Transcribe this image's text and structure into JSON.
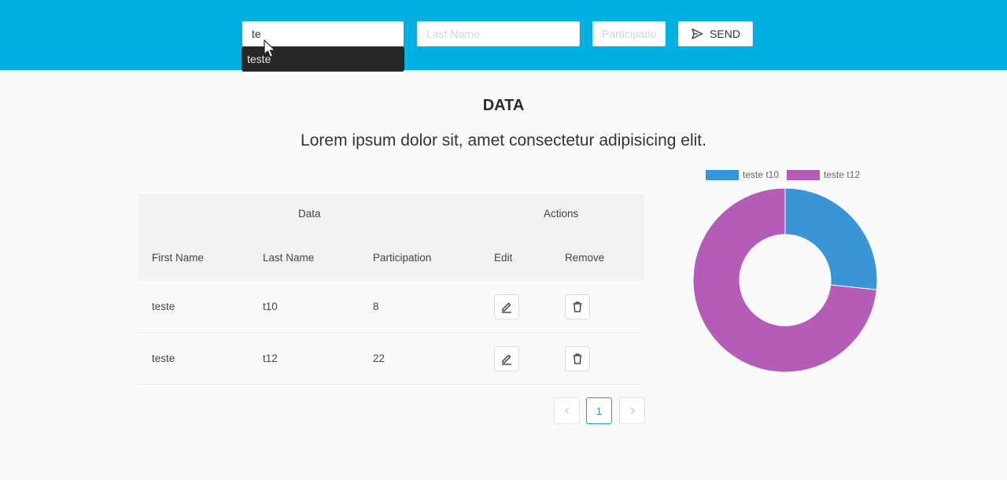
{
  "form": {
    "first_name_value": "te",
    "last_name_placeholder": "Last Name",
    "participation_placeholder": "Participation",
    "send_label": "SEND"
  },
  "autocomplete": {
    "suggestion": "teste"
  },
  "header": {
    "title": "DATA",
    "subtitle": "Lorem ipsum dolor sit, amet consectetur adipisicing elit."
  },
  "table": {
    "group_data": "Data",
    "group_actions": "Actions",
    "columns": [
      "First Name",
      "Last Name",
      "Participation",
      "Edit",
      "Remove"
    ],
    "rows": [
      {
        "first": "teste",
        "last": "t10",
        "participation": "8"
      },
      {
        "first": "teste",
        "last": "t12",
        "participation": "22"
      }
    ]
  },
  "pagination": {
    "current": "1",
    "prev_icon": "chevron-left-icon",
    "next_icon": "chevron-right-icon"
  },
  "colors": {
    "header_bg": "#00b0e0",
    "series1": "#3a95d6",
    "series2": "#b45cb8",
    "accent": "#1890ff"
  },
  "chart_data": {
    "type": "pie",
    "labels": [
      "teste t10",
      "teste t12"
    ],
    "values": [
      8,
      22
    ],
    "colors": [
      "#3a95d6",
      "#b45cb8"
    ],
    "legend": "top"
  }
}
